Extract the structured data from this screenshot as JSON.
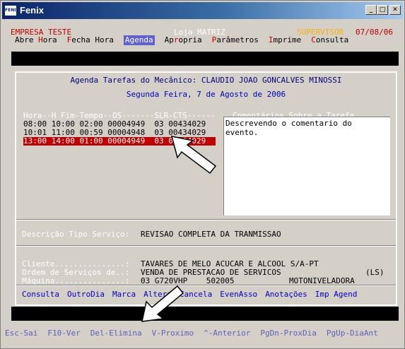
{
  "window": {
    "title": "Fenix",
    "icon_text": "FENIX"
  },
  "header": {
    "company": "EMPRESA TESTE",
    "store": "Loja MATRIZ",
    "user": "SUPERVISOR",
    "date": "07/08/06"
  },
  "menu": [
    {
      "hot": "",
      "rest": "Abre ",
      "hot2": "H",
      "rest2": "ora",
      "active": false
    },
    {
      "hot": "F",
      "rest": "echa Hora",
      "active": false
    },
    {
      "hot": "",
      "rest": "Agenda",
      "active": true
    },
    {
      "hot": "",
      "rest": "Ap",
      "hot2": "r",
      "rest2": "opria",
      "active": false
    },
    {
      "hot": "P",
      "rest": "arâmetros",
      "active": false
    },
    {
      "hot": "I",
      "rest": "mprime",
      "active": false
    },
    {
      "hot": "C",
      "rest": "onsulta",
      "active": false
    }
  ],
  "agenda": {
    "title": "Agenda Tarefas do Mecânico: CLAUDIO JOAO GONCALVES MINOSSI",
    "date_line": "Segunda Feira, 7 de Agosto de 2006",
    "list_header": "Hora--H Fim-Tempo--OS-------SLR-CTS------",
    "rows": [
      "08:00 10:00 02:00 00004949  03 00434029",
      "10:01 11:00 00:59 00004948  03 00434029",
      "13:00 14:00 01:00 00004949  03 00434029"
    ],
    "selected_row": 2,
    "comments_label": "Comentários Sobre a Tarefa",
    "comments_text": "Descrevendo o comentario do\nevento."
  },
  "service": {
    "label": "Descrição Tipo Serviço:",
    "value": "REVISAO COMPLETA DA TRANMISSAO"
  },
  "details": {
    "client_label": "Cliente...............:",
    "client_value": "TAVARES DE MELO ACUCAR E ALCOOL S/A-PT",
    "order_label": "Ordem de Serviços de..:",
    "order_value": "VENDA DE PRESTACAO DE SERVICOS",
    "order_code": "(LS)",
    "machine_label": "Máquina...............:",
    "machine_value": "03 G720VHP    502005",
    "machine_type": "MOTONIVELADORA"
  },
  "actions": [
    "Consulta",
    "OutroDia",
    "Marca",
    "Altera",
    "Cancela",
    "EvenAsso",
    "Anotações",
    "Imp Agend"
  ],
  "fkeys": [
    "Esc-Sai",
    "F10-Ver",
    "Del-Elimina",
    "V-Proximo",
    "^-Anterior",
    "PgDn-ProxDia",
    "PgUp-DiaAnt"
  ]
}
